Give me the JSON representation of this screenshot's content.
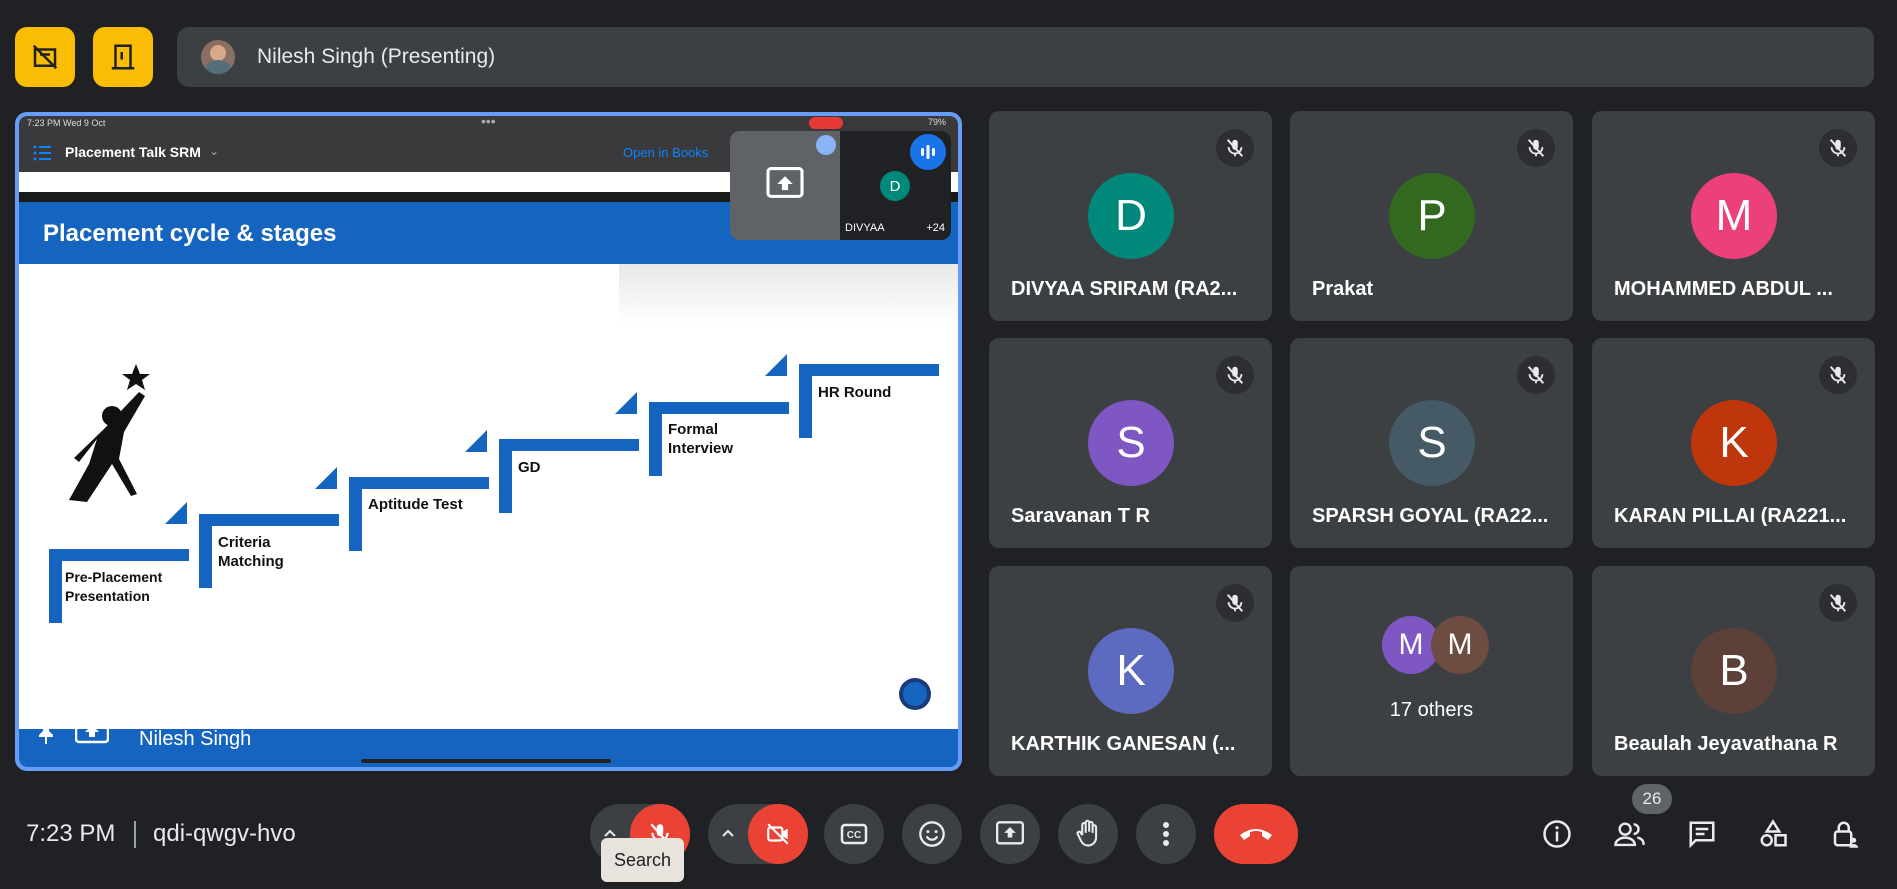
{
  "presenter": {
    "name": "Nilesh Singh (Presenting)",
    "stage_name": "Nilesh Singh"
  },
  "slide": {
    "ipad_time": "7:23 PM   Wed 9 Oct",
    "ipad_battery": "79%",
    "doc_title": "Placement Talk SRM",
    "open_in_books": "Open in Books",
    "heading": "Placement cycle & stages",
    "steps": [
      "Pre-Placement Presentation",
      "Criteria Matching",
      "Aptitude Test",
      "GD",
      "Formal Interview",
      "HR Round"
    ],
    "pip_name": "DIVYAA",
    "pip_initial": "D",
    "pip_count": "+24"
  },
  "participants": [
    {
      "initial": "D",
      "name": "DIVYAA SRIRAM (RA2...",
      "color": "#00897b"
    },
    {
      "initial": "P",
      "name": "Prakat",
      "color": "#33691e"
    },
    {
      "initial": "M",
      "name": "MOHAMMED ABDUL ...",
      "color": "#ec407a"
    },
    {
      "initial": "S",
      "name": "Saravanan T R",
      "color": "#7e57c2"
    },
    {
      "initial": "S",
      "name": "SPARSH GOYAL (RA22...",
      "color": "#455a64"
    },
    {
      "initial": "K",
      "name": "KARAN PILLAI (RA221...",
      "color": "#bf360c"
    },
    {
      "initial": "K",
      "name": "KARTHIK GANESAN (...",
      "color": "#5c6bc0"
    },
    {
      "initial": "M",
      "name": "17 others",
      "color": "#7e57c2",
      "initial2": "M",
      "color2": "#6d4c41"
    },
    {
      "initial": "B",
      "name": "Beaulah Jeyavathana R",
      "color": "#5d4037"
    }
  ],
  "footer": {
    "time": "7:23 PM",
    "meeting_code": "qdi-qwgv-hvo",
    "tooltip": "Search",
    "people_count": "26"
  }
}
